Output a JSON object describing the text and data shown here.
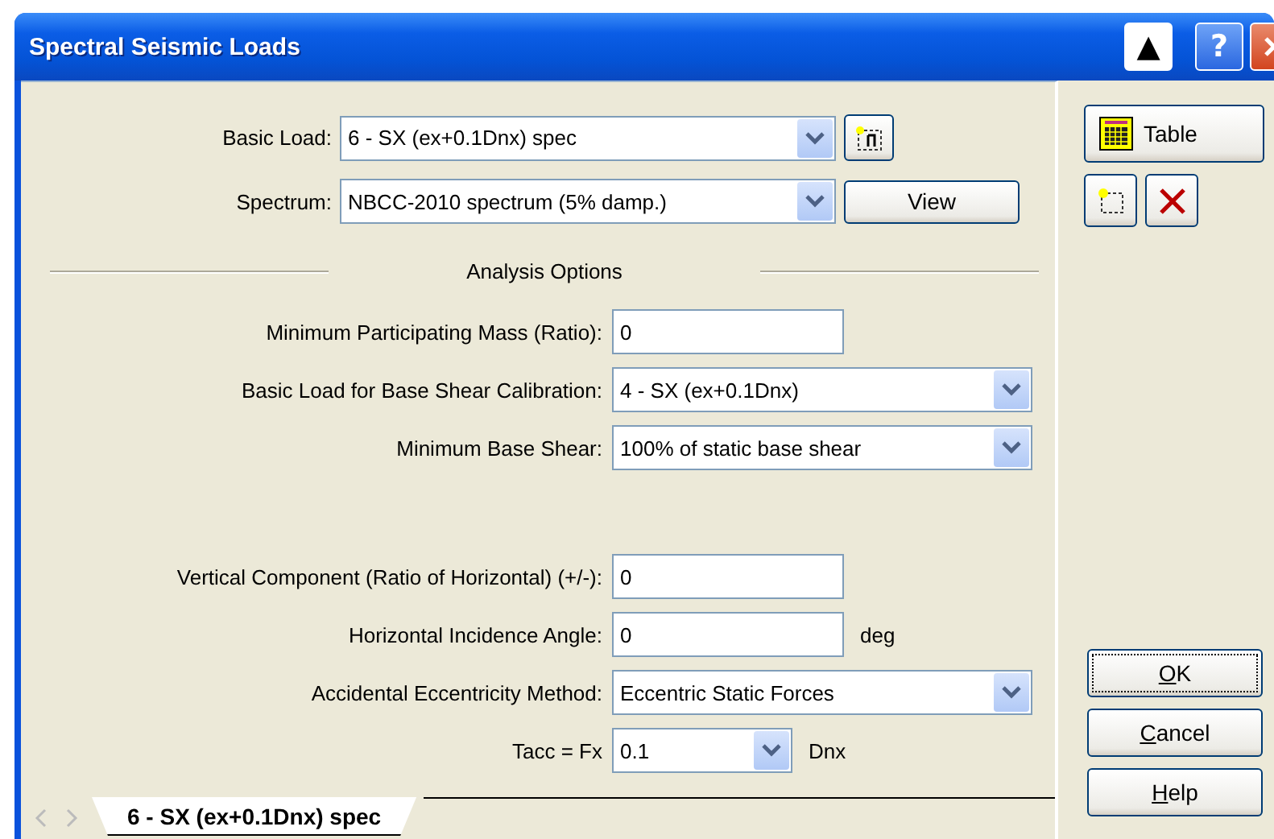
{
  "window": {
    "title": "Spectral Seismic Loads",
    "title_buttons": [
      {
        "kind": "rollup",
        "label": "▲"
      },
      {
        "kind": "help",
        "label": "?"
      },
      {
        "kind": "close"
      }
    ]
  },
  "basic_load": {
    "label": "Basic Load:",
    "value": "6 - SX (ex+0.1Dnx) spec"
  },
  "spectrum": {
    "label": "Spectrum:",
    "value": "NBCC-2010 spectrum (5% damp.)",
    "button": "View"
  },
  "section_title": "Analysis Options",
  "options": [
    {
      "kind": "input",
      "label": "Minimum Participating Mass (Ratio):",
      "value": "0"
    },
    {
      "kind": "dropdown",
      "label": "Basic Load for Base Shear Calibration:",
      "value": "4 - SX (ex+0.1Dnx)"
    },
    {
      "kind": "dropdown",
      "label": "Minimum Base Shear:",
      "value": "100% of static base shear"
    },
    {
      "kind": "spacer"
    },
    {
      "kind": "input",
      "label": "Vertical Component (Ratio of Horizontal) (+/-):",
      "value": "0"
    },
    {
      "kind": "input",
      "label": "Horizontal Incidence Angle:",
      "value": "0",
      "suffix": "deg"
    },
    {
      "kind": "dropdown",
      "label": "Accidental Eccentricity Method:",
      "value": "Eccentric Static Forces"
    },
    {
      "kind": "small_dropdown",
      "label": "Tacc = Fx",
      "value": "0.1",
      "suffix": "Dnx"
    }
  ],
  "tabs": [
    {
      "label": "6 - SX (ex+0.1Dnx) spec",
      "selected": true
    }
  ],
  "table_button": "Table",
  "dialog_buttons": [
    {
      "key": "O",
      "rest": "K",
      "focused": true
    },
    {
      "key": "C",
      "rest": "ancel",
      "focused": false
    },
    {
      "key": "H",
      "rest": "elp",
      "focused": false
    }
  ]
}
